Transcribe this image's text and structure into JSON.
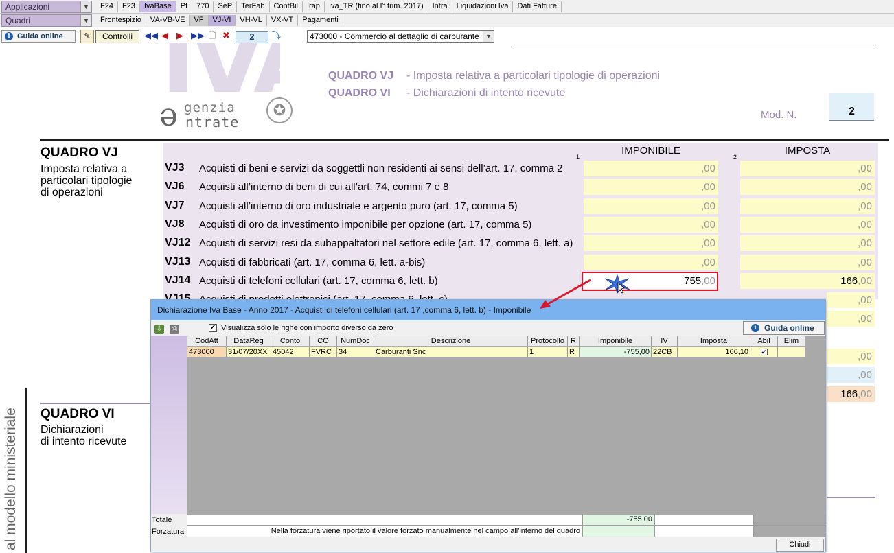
{
  "toolbar": {
    "applicazioni_label": "Applicazioni",
    "quadri_label": "Quadri",
    "menu_row1": [
      "F24",
      "F23",
      "IvaBase",
      "Pf",
      "770",
      "SeP",
      "TerFab",
      "ContBil",
      "Irap",
      "Iva_TR (fino al I° trim. 2017)",
      "Intra",
      "Liquidazioni Iva",
      "Dati Fatture"
    ],
    "menu_row2": [
      "Frontespizio",
      "VA-VB-VE",
      "VF",
      "VJ-VI",
      "VH-VL",
      "VX-VT",
      "Pagamenti"
    ],
    "guida_label": "Guida online",
    "controlli_label": "Controlli",
    "page_number": "2",
    "ateco_value": "473000 - Commercio al dettaglio di carburante"
  },
  "header": {
    "logo_text": "IVA",
    "agenzia_top": "genzia",
    "agenzia_bottom": "ntrate",
    "line1_code": "QUADRO VJ",
    "line1_desc": "- Imposta relativa a particolari tipologie di operazioni",
    "line2_code": "QUADRO VI",
    "line2_desc": "- Dichiarazioni di intento ricevute",
    "modn_label": "Mod. N.",
    "modn_value": "2"
  },
  "vj": {
    "title": "QUADRO VJ",
    "subtitle": [
      "Imposta relativa a",
      "particolari tipologie",
      "di operazioni"
    ],
    "col1_num": "1",
    "col1_label": "IMPONIBILE",
    "col2_num": "2",
    "col2_label": "IMPOSTA",
    "rows": [
      {
        "code": "VJ3",
        "label": "Acquisti di beni e servizi da soggettli non residenti ai sensi dell’art. 17, comma 2",
        "imponibile": "",
        "imposta": ""
      },
      {
        "code": "VJ6",
        "label": "Acquisti all’interno di beni di cui all’art. 74, commi 7 e 8",
        "imponibile": "",
        "imposta": ""
      },
      {
        "code": "VJ7",
        "label": "Acquisti all’interno di oro industriale e argento puro (art. 17, comma 5)",
        "imponibile": "",
        "imposta": ""
      },
      {
        "code": "VJ8",
        "label": "Acquisti di oro da investimento imponibile per opzione (art. 17, comma 5)",
        "imponibile": "",
        "imposta": ""
      },
      {
        "code": "VJ12",
        "label": "Acquisti di servizi resi da subappaltatori nel settore edile (art. 17, comma 6, lett. a)",
        "imponibile": "",
        "imposta": ""
      },
      {
        "code": "VJ13",
        "label": "Acquisti di fabbricati (art. 17, comma 6, lett. a-bis)",
        "imponibile": "",
        "imposta": ""
      },
      {
        "code": "VJ14",
        "label": "Acquisti di telefoni cellulari (art. 17, comma 6, lett. b)",
        "imponibile": "755",
        "imposta": "166"
      },
      {
        "code": "VJ15",
        "label": "Acquisti di prodotti elettronici (art. 17, comma 6, lett. c)",
        "imponibile": "",
        "imposta": ""
      }
    ],
    "decimal_suffix": ",00",
    "extra_imposta_cells": [
      "",
      "",
      "",
      "",
      "166"
    ]
  },
  "vi": {
    "title": "QUADRO VI",
    "subtitle": [
      "Dichiarazioni",
      "di intento ricevute"
    ]
  },
  "side_text": "al modello ministeriale",
  "dialog": {
    "title": "Dichiarazione Iva Base - Anno 2017 - Acquisti di telefoni cellulari (art. 17 ,comma 6, lett. b)  - Imponibile",
    "filter_label": "Visualizza solo le righe con importo diverso da zero",
    "guida_label": "Guida online",
    "columns": [
      "CodAtt",
      "DataReg",
      "Conto",
      "CO",
      "NumDoc",
      "Descrizione",
      "Protocollo",
      "R",
      "Imponibile",
      "IV",
      "Imposta",
      "Abil",
      "Elim"
    ],
    "rows": [
      {
        "codatt": "473000",
        "datareg": "31/07/20XX",
        "conto": "45042",
        "co": "FVRC",
        "numdoc": "34",
        "descrizione": "Carburanti Snc",
        "protocollo": "1",
        "r": "R",
        "imponibile": "-755,00",
        "iv": "22CB",
        "imposta": "166,10",
        "abil": "✔",
        "elim": ""
      }
    ],
    "totale_label": "Totale",
    "totale_value": "-755,00",
    "forzatura_label": "Forzatura",
    "forzatura_note": "Nella forzatura viene riportato il valore forzato manualmente nel campo all'interno del quadro",
    "chiudi_label": "Chiudi"
  },
  "colors": {
    "accent_purple": "#c9b9e6",
    "input_yellow": "#fdfcc8",
    "highlight_red": "#d9182d",
    "dialog_title_blue": "#79b2ee"
  }
}
